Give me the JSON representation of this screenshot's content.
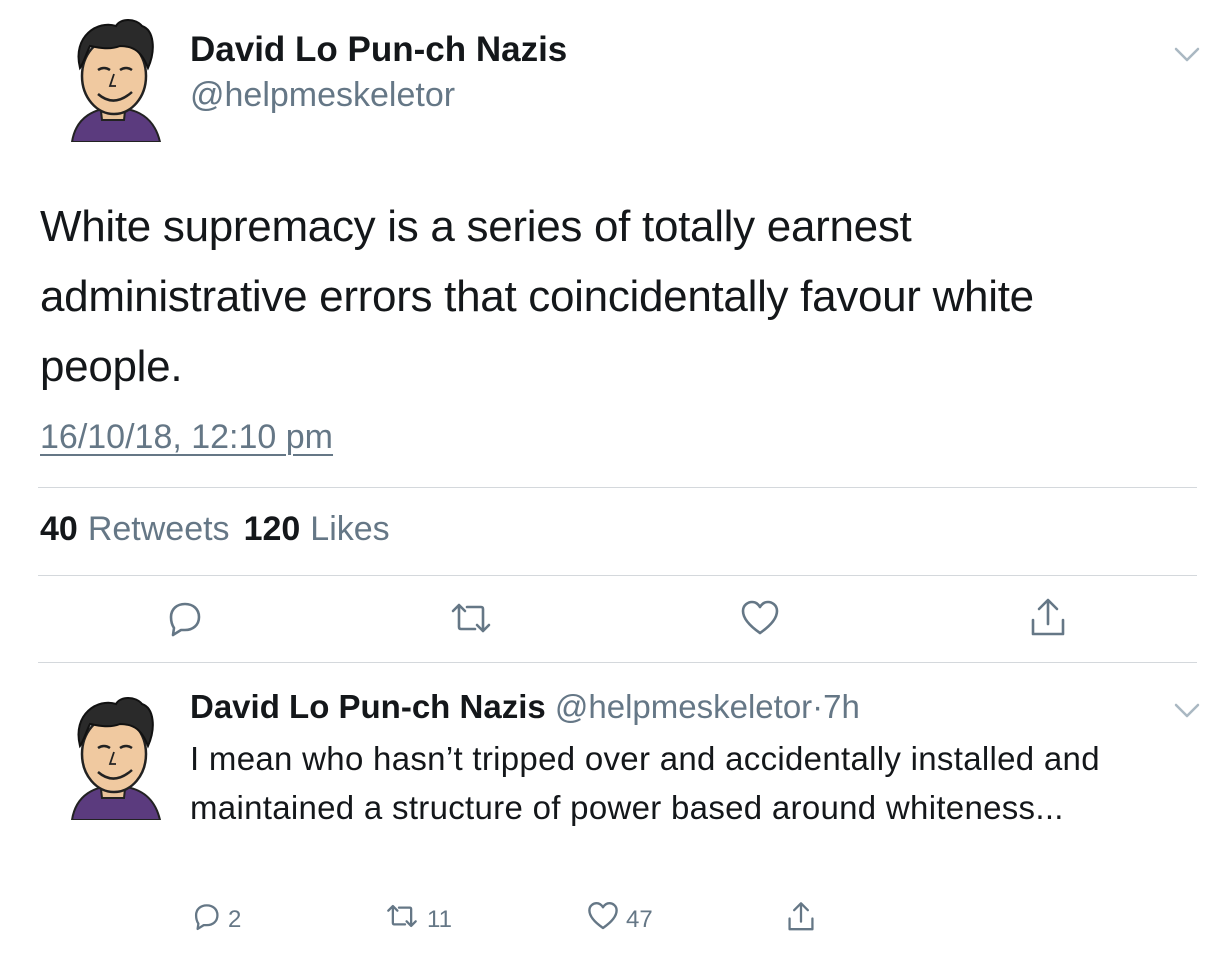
{
  "tweet": {
    "author_name": "David Lo Pun-ch Nazis",
    "author_handle": "@helpmeskeletor",
    "text": "White supremacy is a series of totally earnest administrative errors that coincidentally favour white people.",
    "timestamp": "16/10/18, 12:10 pm",
    "stats": {
      "retweets_count": "40",
      "retweets_label": "Retweets",
      "likes_count": "120",
      "likes_label": "Likes"
    },
    "actions": [
      "reply-icon",
      "retweet-icon",
      "like-icon",
      "share-icon"
    ]
  },
  "reply": {
    "author_name": "David Lo Pun-ch Nazis",
    "author_handle": "@helpmeskeletor",
    "separator": "·",
    "age": "7h",
    "text": "I mean who hasn’t tripped over and accidentally installed and maintained a structure of power based around whiteness...",
    "reply_count": "2",
    "retweet_count": "11",
    "like_count": "47"
  },
  "colors": {
    "text": "#14171a",
    "secondary": "#657786",
    "divider": "#d4d8dc",
    "shirt": "#5b3b7e"
  }
}
